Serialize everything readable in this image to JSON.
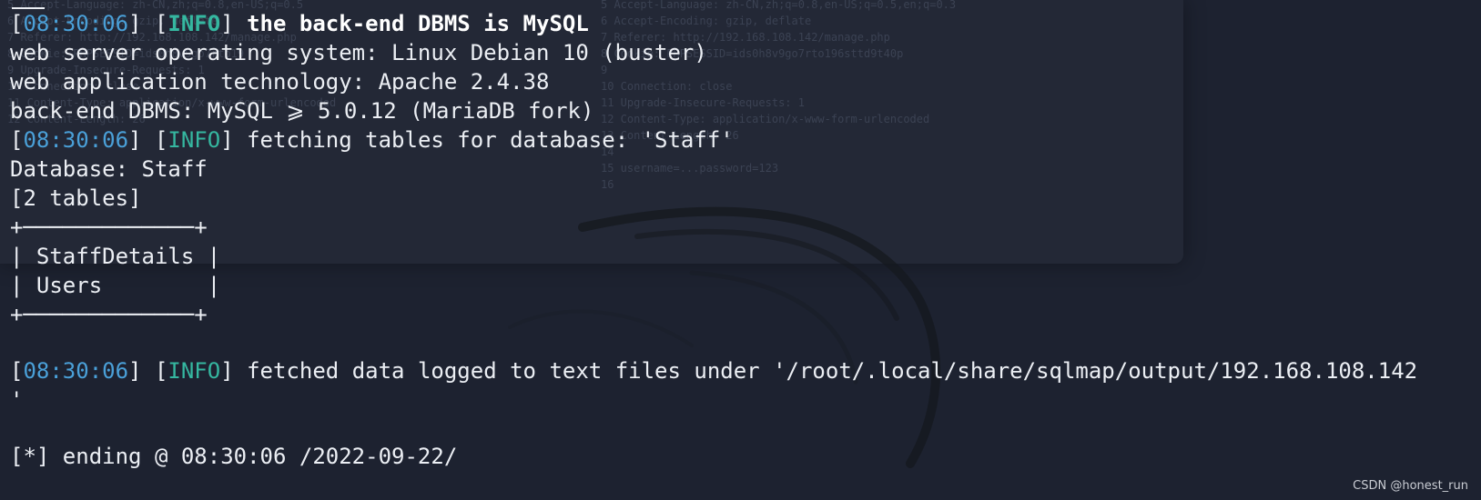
{
  "terminal": {
    "line1": {
      "open": "[",
      "time": "08:30:06",
      "mid": "] [",
      "tag": "INFO",
      "close": "] ",
      "msg": "the back-end DBMS is MySQL"
    },
    "line2": "web server operating system: Linux Debian 10 (buster)",
    "line3": "web application technology: Apache 2.4.38",
    "line4": "back-end DBMS: MySQL ⩾ 5.0.12 (MariaDB fork)",
    "line5": {
      "open": "[",
      "time": "08:30:06",
      "mid": "] [",
      "tag": "INFO",
      "close": "] ",
      "msg": "fetching tables for database: 'Staff'"
    },
    "line6": "Database: Staff",
    "line7": "[2 tables]",
    "table": {
      "border_top": "+─────────────+",
      "row1": "| StaffDetails |",
      "row2": "| Users        |",
      "border_bottom": "+─────────────+"
    },
    "line8": {
      "open": "[",
      "time": "08:30:06",
      "mid": "] [",
      "tag": "INFO",
      "close": "] ",
      "msg": "fetched data logged to text files under '/root/.local/share/sqlmap/output/192.168.108.142"
    },
    "line8_cont": "'",
    "line9": "[*] ending @ 08:30:06 /2022-09-22/"
  },
  "watermark": "CSDN @honest_run",
  "ghost": {
    "left_lines": "5 Accept-Language: zh-CN,zh;q=0.8,en-US;q=0.5\n6 Accept-Encoding: gzip, deflate\n7 Referer: http://192.168.108.142/manage.php\n8 Cookie: PHPSESSID=ids0h8v9go7rto19\n9 Upgrade-Insecure-Requests: 1\n10 Connection: close\n11 Content-Type: application/x-www-form-urlencoded\n12 Content-Length: 26",
    "right_lines": "5 Accept-Language: zh-CN,zh;q=0.8,en-US;q=0.5,en;q=0.3\n6 Accept-Encoding: gzip, deflate\n7 Referer: http://192.168.108.142/manage.php\n8 Cookie: PHPSESSID=ids0h8v9go7rto196sttd9t40p\n9\n10 Connection: close\n11 Upgrade-Insecure-Requests: 1\n12 Content-Type: application/x-www-form-urlencoded\n13 Content-Length: 26\n14\n15 username=...password=123\n16"
  },
  "colors": {
    "background": "#1d2230",
    "timestamp": "#4aa0d8",
    "info": "#35b7a0",
    "text": "#eceff4"
  }
}
